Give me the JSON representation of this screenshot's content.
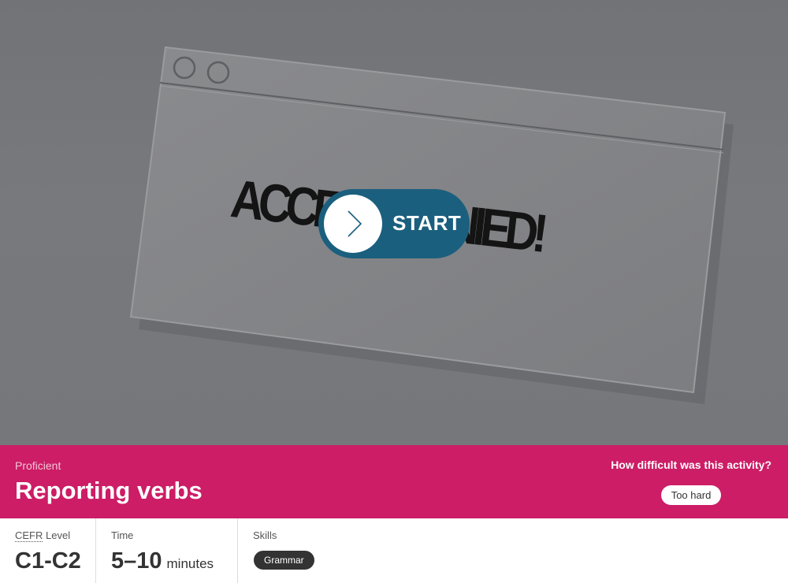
{
  "hero": {
    "sign_text": "ACCESS DENIED!",
    "start_label": "START",
    "button_color": "#1b5f7e"
  },
  "banner": {
    "level": "Proficient",
    "title": "Reporting verbs",
    "difficulty_question": "How difficult was this activity?",
    "difficulty_option": "Too hard",
    "color": "#cc1d66"
  },
  "info": {
    "cefr": {
      "label_abbr": "CEFR",
      "label_rest": " Level",
      "value": "C1-C2"
    },
    "time": {
      "label": "Time",
      "value": "5–10",
      "unit": "minutes"
    },
    "skills": {
      "label": "Skills",
      "items": [
        "Grammar"
      ]
    }
  },
  "icons": {
    "start": "chevron-right-icon",
    "window_dots": "window-button-icon"
  }
}
